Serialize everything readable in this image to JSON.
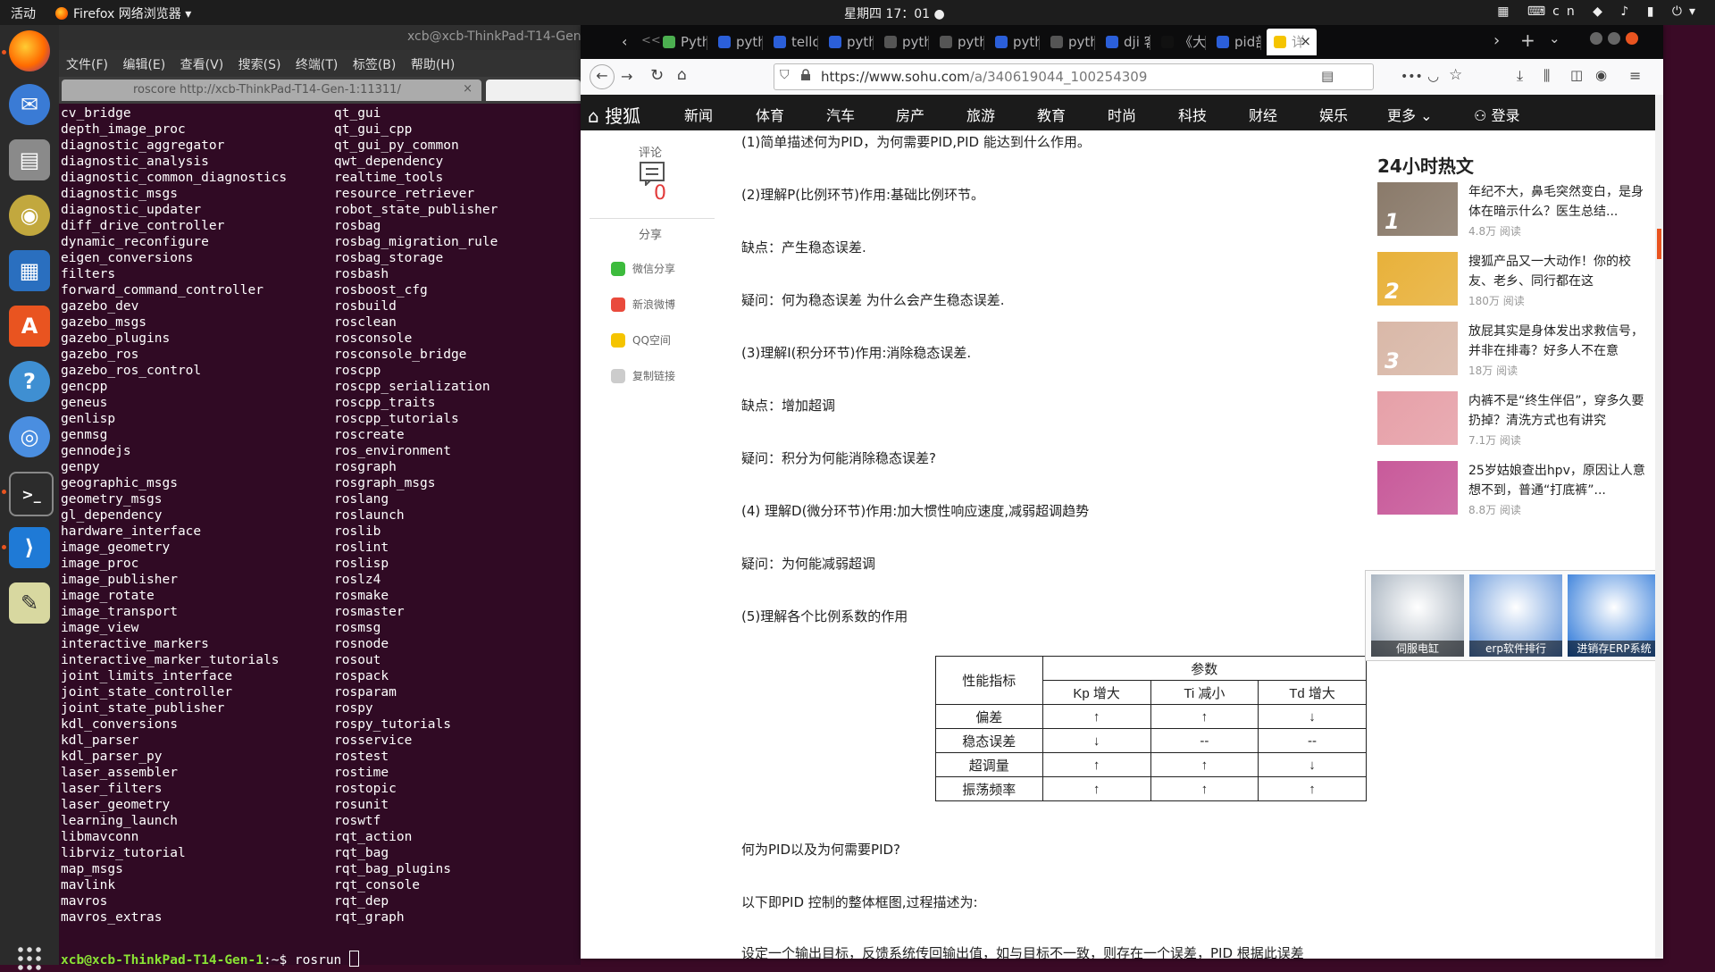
{
  "topbar": {
    "activities": "活动",
    "app_name": "Firefox 网络浏览器 ▾",
    "clock": "星期四 17：01 ●",
    "tray": "▦ ⌨cn ◆ ♪ ▮ ⏻▾"
  },
  "dock": {
    "items": [
      "firefox-icon",
      "thunderbird-icon",
      "files-icon",
      "rhythmbox-icon",
      "writer-icon",
      "software-center-icon",
      "help-icon",
      "chromium-icon",
      "terminal-icon",
      "vscode-icon",
      "gedit-icon",
      "show-apps-icon"
    ]
  },
  "terminal": {
    "title": "xcb@xcb-ThinkPad-T14-Gen",
    "menu": [
      "文件(F)",
      "编辑(E)",
      "查看(V)",
      "搜索(S)",
      "终端(T)",
      "标签(B)",
      "帮助(H)"
    ],
    "tab_title": "roscore http://xcb-ThinkPad-T14-Gen-1:11311/",
    "tab_close": "×",
    "col1": [
      "cv_bridge",
      "depth_image_proc",
      "diagnostic_aggregator",
      "diagnostic_analysis",
      "diagnostic_common_diagnostics",
      "diagnostic_msgs",
      "diagnostic_updater",
      "diff_drive_controller",
      "dynamic_reconfigure",
      "eigen_conversions",
      "filters",
      "forward_command_controller",
      "gazebo_dev",
      "gazebo_msgs",
      "gazebo_plugins",
      "gazebo_ros",
      "gazebo_ros_control",
      "gencpp",
      "geneus",
      "genlisp",
      "genmsg",
      "gennodejs",
      "genpy",
      "geographic_msgs",
      "geometry_msgs",
      "gl_dependency",
      "hardware_interface",
      "image_geometry",
      "image_proc",
      "image_publisher",
      "image_rotate",
      "image_transport",
      "image_view",
      "interactive_markers",
      "interactive_marker_tutorials",
      "joint_limits_interface",
      "joint_state_controller",
      "joint_state_publisher",
      "kdl_conversions",
      "kdl_parser",
      "kdl_parser_py",
      "laser_assembler",
      "laser_filters",
      "laser_geometry",
      "learning_launch",
      "libmavconn",
      "librviz_tutorial",
      "map_msgs",
      "mavlink",
      "mavros",
      "mavros_extras"
    ],
    "col2": [
      "qt_gui",
      "qt_gui_cpp",
      "qt_gui_py_common",
      "qwt_dependency",
      "realtime_tools",
      "resource_retriever",
      "robot_state_publisher",
      "rosbag",
      "rosbag_migration_rule",
      "rosbag_storage",
      "rosbash",
      "rosboost_cfg",
      "rosbuild",
      "rosclean",
      "rosconsole",
      "rosconsole_bridge",
      "roscpp",
      "roscpp_serialization",
      "roscpp_traits",
      "roscpp_tutorials",
      "roscreate",
      "ros_environment",
      "rosgraph",
      "rosgraph_msgs",
      "roslang",
      "roslaunch",
      "roslib",
      "roslint",
      "roslisp",
      "roslz4",
      "rosmake",
      "rosmaster",
      "rosmsg",
      "rosnode",
      "rosout",
      "rospack",
      "rosparam",
      "rospy",
      "rospy_tutorials",
      "rosservice",
      "rostest",
      "rostime",
      "rostopic",
      "rosunit",
      "roswtf",
      "rqt_action",
      "rqt_bag",
      "rqt_bag_plugins",
      "rqt_console",
      "rqt_dep",
      "rqt_graph"
    ],
    "prompt_user": "xcb@xcb-ThinkPad-T14-Gen-1",
    "prompt_rest": ":~$ rosrun "
  },
  "firefox": {
    "tabs": [
      {
        "label": "<<",
        "fav": "#333"
      },
      {
        "label": "Pyth",
        "fav": "#4caf50"
      },
      {
        "label": "pyth",
        "fav": "#2b5fd9"
      },
      {
        "label": "tello",
        "fav": "#2b5fd9"
      },
      {
        "label": "pyth",
        "fav": "#2b5fd9"
      },
      {
        "label": "pyth",
        "fav": "#555"
      },
      {
        "label": "pyth",
        "fav": "#555"
      },
      {
        "label": "pyth",
        "fav": "#2b5fd9"
      },
      {
        "label": "pyth",
        "fav": "#555"
      },
      {
        "label": "dji 客",
        "fav": "#2b5fd9"
      },
      {
        "label": "《大",
        "fav": "#111"
      },
      {
        "label": "pid剖",
        "fav": "#2b5fd9"
      },
      {
        "label": "详",
        "fav": "#f5c400"
      }
    ],
    "tab_close": "×",
    "url_host": "https://www.sohu.com",
    "url_path": "/a/340619044_100254309",
    "nav_icons": [
      "back-icon",
      "forward-icon",
      "reload-icon",
      "home-icon"
    ]
  },
  "sohu": {
    "logo": "搜狐",
    "nav": [
      "新闻",
      "体育",
      "汽车",
      "房产",
      "旅游",
      "教育",
      "时尚",
      "科技",
      "财经",
      "娱乐",
      "更多"
    ],
    "login": "登录",
    "comment_label": "评论",
    "comment_count": "0",
    "share_label": "分享",
    "share": [
      {
        "label": "微信分享",
        "color": "#3dbb3d"
      },
      {
        "label": "新浪微博",
        "color": "#e94a3c"
      },
      {
        "label": "QQ空间",
        "color": "#f5c400"
      },
      {
        "label": "复制链接",
        "color": "#cccccc"
      }
    ],
    "article": [
      "(1)简单描述何为PID，为何需要PID,PID 能达到什么作用。",
      "(2)理解P(比例环节)作用:基础比例环节。",
      "缺点：产生稳态误差.",
      "疑问：何为稳态误差 为什么会产生稳态误差.",
      "(3)理解I(积分环节)作用:消除稳态误差.",
      "缺点：增加超调",
      "疑问：积分为何能消除稳态误差?",
      "(4) 理解D(微分环节)作用:加大惯性响应速度,减弱超调趋势",
      "疑问：为何能减弱超调",
      "(5)理解各个比例系数的作用",
      "何为PID以及为何需要PID?",
      "以下即PID 控制的整体框图,过程描述为:",
      "设定一个输出目标，反馈系统传回输出值，如与目标不一致，则存在一个误差，PID 根据此误差"
    ],
    "table": {
      "corner": "性能指标",
      "group": "参数",
      "headers": [
        "Kp 增大",
        "Ti 减小",
        "Td 增大"
      ],
      "rows": [
        {
          "name": "偏差",
          "cells": [
            "↑",
            "↑",
            "↓"
          ]
        },
        {
          "name": "稳态误差",
          "cells": [
            "↓",
            "--",
            "--"
          ]
        },
        {
          "name": "超调量",
          "cells": [
            "↑",
            "↑",
            "↓"
          ]
        },
        {
          "name": "振荡频率",
          "cells": [
            "↑",
            "↑",
            "↑"
          ]
        }
      ]
    },
    "hot_title": "24小时热文",
    "hot": [
      {
        "rank": "1",
        "title": "年纪不大，鼻毛突然变白，是身体在暗示什么？医生总结...",
        "meta": "4.8万 阅读",
        "color": "#8a7a6a"
      },
      {
        "rank": "2",
        "title": "搜狐产品又一大动作！你的校友、老乡、同行都在这",
        "meta": "180万 阅读",
        "color": "#e8b13a"
      },
      {
        "rank": "3",
        "title": "放屁其实是身体发出求救信号，并非在排毒？好多人不在意",
        "meta": "18万 阅读",
        "color": "#d9b8a8"
      },
      {
        "rank": "",
        "title": "内裤不是“终生伴侣”，穿多久要扔掉？清洗方式也有讲究",
        "meta": "7.1万 阅读",
        "color": "#e6a0a8"
      },
      {
        "rank": "",
        "title": "25岁姑娘查出hpv，原因让人意想不到，普通“打底裤”...",
        "meta": "8.8万 阅读",
        "color": "#c85a9a"
      }
    ],
    "ads": [
      {
        "label": "伺服电缸",
        "color": "#9aa7b5"
      },
      {
        "label": "erp软件排行",
        "color": "#5a8fd8"
      },
      {
        "label": "进销存ERP系统",
        "color": "#1f6fd6"
      }
    ]
  }
}
